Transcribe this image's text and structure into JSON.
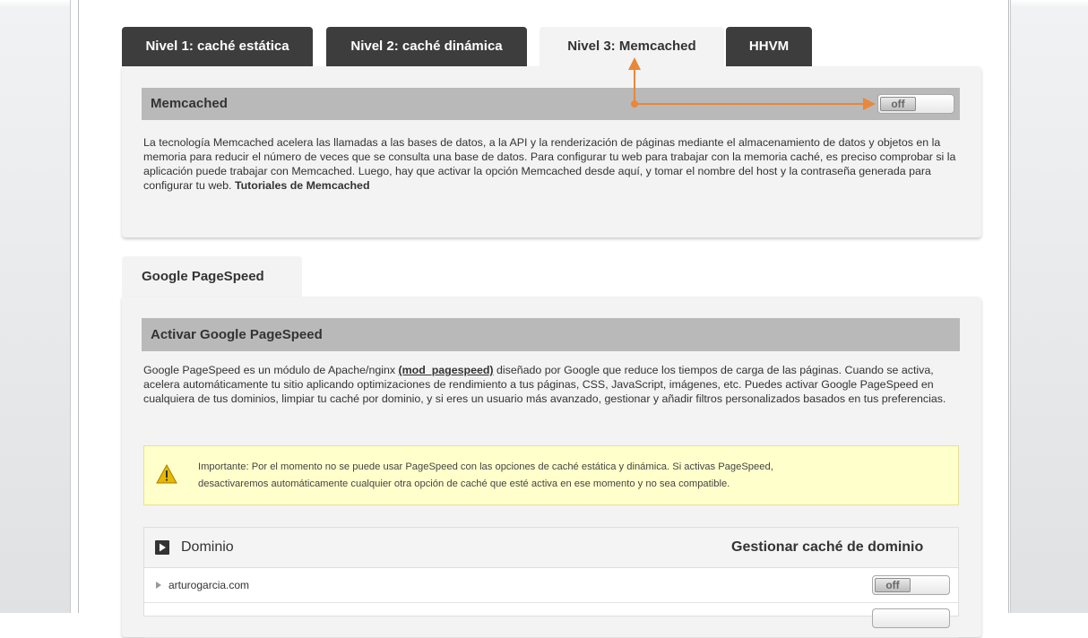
{
  "tabs": [
    {
      "label": "Nivel 1: caché estática"
    },
    {
      "label": "Nivel 2: caché dinámica"
    },
    {
      "label": "Nivel 3: Memcached"
    },
    {
      "label": "HHVM"
    }
  ],
  "memcached": {
    "title": "Memcached",
    "toggle": "off",
    "description": "La tecnología Memcached acelera las llamadas a las bases de datos, a la API y la renderización de páginas mediante el almacenamiento de datos y objetos en la memoria para reducir el número de veces que se consulta una base de datos. Para configurar tu web para trabajar con la memoria caché, es preciso comprobar si la aplicación puede trabajar con Memcached. Luego, hay que activar la opción Memcached desde aquí, y tomar el nombre del host y la contraseña generada para configurar tu web.",
    "link": "Tutoriales de Memcached"
  },
  "pagespeed": {
    "tab": "Google PageSpeed",
    "title": "Activar Google PageSpeed",
    "desc_before": "Google PageSpeed es un módulo de Apache/nginx",
    "module": "(mod_pagespeed)",
    "desc_after": "diseñado por Google que reduce los tiempos de carga de las páginas. Cuando se activa, acelera automáticamente tu sitio aplicando optimizaciones de rendimiento a tus páginas, CSS, JavaScript, imágenes, etc. Puedes activar Google PageSpeed en cualquiera de tus dominios, limpiar tu caché por dominio, y si eres un usuario más avanzado, gestionar y añadir filtros personalizados basados en tus preferencias.",
    "warning_line1": "Importante: Por el momento no se puede usar PageSpeed con las opciones de caché estática y dinámica. Si activas PageSpeed,",
    "warning_line2": "desactivaremos automáticamente cualquier otra opción de caché que esté activa en ese momento y no sea compatible."
  },
  "table": {
    "col_domain": "Dominio",
    "col_manage": "Gestionar caché de dominio",
    "rows": [
      {
        "domain": "arturogarcia.com",
        "toggle": "off"
      }
    ]
  },
  "colors": {
    "tab_dark": "#3d3d3d",
    "panel": "#f3f3f3",
    "section_bar": "#b9b9b9",
    "annotation_arrow": "#e8883a",
    "warning_bg": "#ffffcc"
  }
}
